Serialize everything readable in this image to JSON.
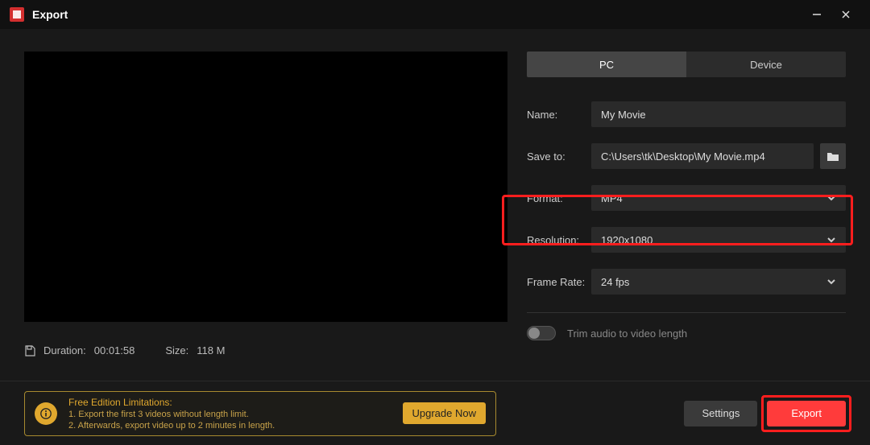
{
  "window": {
    "title": "Export"
  },
  "tabs": {
    "pc": "PC",
    "device": "Device"
  },
  "labels": {
    "name": "Name:",
    "saveTo": "Save to:",
    "format": "Format:",
    "resolution": "Resolution:",
    "frameRate": "Frame Rate:",
    "trim": "Trim audio to video length"
  },
  "values": {
    "name": "My Movie",
    "saveTo": "C:\\Users\\tk\\Desktop\\My Movie.mp4",
    "format": "MP4",
    "resolution": "1920x1080",
    "frameRate": "24 fps"
  },
  "meta": {
    "durationLabel": "Duration:",
    "duration": "00:01:58",
    "sizeLabel": "Size:",
    "size": "118 M"
  },
  "limitations": {
    "title": "Free Edition Limitations:",
    "line1": "1. Export the first 3 videos without length limit.",
    "line2": "2. Afterwards, export video up to 2 minutes in length.",
    "upgrade": "Upgrade Now"
  },
  "buttons": {
    "settings": "Settings",
    "export": "Export"
  }
}
